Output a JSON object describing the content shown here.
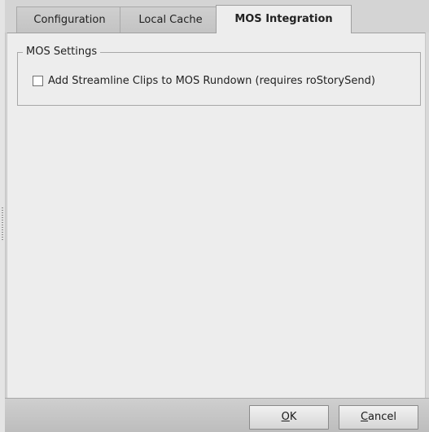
{
  "tabs": {
    "configuration": "Configuration",
    "local_cache": "Local Cache",
    "mos_integration": "MOS Integration",
    "active": "MOS Integration"
  },
  "mos_settings": {
    "group_title": "MOS Settings",
    "checkbox_label": "Add Streamline Clips to MOS Rundown (requires roStorySend)",
    "checkbox_checked": false
  },
  "buttons": {
    "ok_mnemonic": "O",
    "ok_rest": "K",
    "cancel_mnemonic": "C",
    "cancel_rest": "ancel"
  }
}
